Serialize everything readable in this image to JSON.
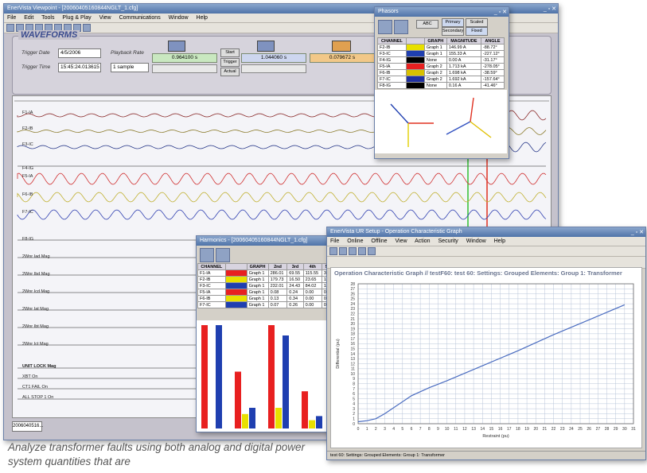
{
  "main": {
    "title": "EnerVista Viewpoint  -  [20060405160844NGLT_1.cfg]",
    "menu": [
      "File",
      "Edit",
      "Tools",
      "Plug & Play",
      "View",
      "Communications",
      "Window",
      "Help"
    ],
    "waveforms_title": "WAVEFORMS",
    "trigger_date_label": "Trigger Date",
    "trigger_date": "4/5/2006",
    "trigger_time_label": "Trigger Time",
    "trigger_time": "15:45:24.013615",
    "playback_label": "Playback Rate",
    "playback_value": "1 sample",
    "cursor1": "0.964100 s",
    "cursor2": "1.044060 s",
    "delta": "0.079672 s",
    "btn_start": "Start",
    "btn_trigger": "Trigger",
    "btn_actual": "Actual",
    "channels": [
      "F1-IA",
      "F2-IB",
      "F3-IC",
      "F4-IG",
      "F5-IA",
      "F6-IB",
      "F7-IC",
      "F8-IG",
      "2Wnr Iad Mag",
      "2Wnr Ibd Mag",
      "2Wnr Icd Mag",
      "2Wnr Iat Mag",
      "2Wnr Ibt Mag",
      "2Wnr Ict Mag"
    ],
    "digital": [
      "UNIT LOCK Mag",
      "XBT    On",
      "CT1 FAIL    On",
      "ALL STOP 1   On"
    ],
    "tab": "2006040516..."
  },
  "phasor": {
    "title": "Phasors",
    "btn_ab": "ABC",
    "btn_primary": "Primary",
    "btn_secondary": "Secondary",
    "btn_scaled": "Scaled",
    "btn_fixed": "Fixed",
    "headers": [
      "CHANNEL",
      "",
      "GRAPH",
      "MAGNITUDE",
      "ANGLE"
    ],
    "rows": [
      {
        "ch": "F2-IB",
        "color": "#e8e000",
        "graph": "Graph 1",
        "mag": "146.99 A",
        "ang": "-88.72°"
      },
      {
        "ch": "F3-IC",
        "color": "#1f3fb0",
        "graph": "Graph 1",
        "mag": "155.33 A",
        "ang": "-227.12°"
      },
      {
        "ch": "F4-IG",
        "color": "#000000",
        "graph": "None",
        "mag": "0.00 A",
        "ang": "-31.17°"
      },
      {
        "ch": "F5-IA",
        "color": "#e82020",
        "graph": "Graph 2",
        "mag": "1.713 kA",
        "ang": "-278.05°"
      },
      {
        "ch": "F6-IB",
        "color": "#d8c000",
        "graph": "Graph 2",
        "mag": "1.698 kA",
        "ang": "-38.59°"
      },
      {
        "ch": "F7-IC",
        "color": "#2030a0",
        "graph": "Graph 2",
        "mag": "1.692 kA",
        "ang": "-157.64°"
      },
      {
        "ch": "F8-IG",
        "color": "#000000",
        "graph": "None",
        "mag": "0.16 A",
        "ang": "-41.46°"
      }
    ]
  },
  "harmonic": {
    "title": "Harmonics  -  [20060405160844NGLT_1.cfg]",
    "headers": [
      "CHANNEL",
      "",
      "GRAPH",
      "2nd",
      "3rd",
      "4th",
      "5th"
    ],
    "rows": [
      {
        "ch": "F1-IA",
        "color": "#e82020",
        "graph": "Graph 1",
        "v": [
          "286.01",
          "69.55",
          "115.55",
          "38.1"
        ]
      },
      {
        "ch": "F2-IB",
        "color": "#e8e000",
        "graph": "Graph 1",
        "v": [
          "179.73",
          "16.50",
          "23.65",
          "10.0"
        ]
      },
      {
        "ch": "F3-IC",
        "color": "#1f3fb0",
        "graph": "Graph 1",
        "v": [
          "232.01",
          "24.43",
          "84.02",
          "15.1"
        ]
      },
      {
        "ch": "F5-IA",
        "color": "#e82020",
        "graph": "Graph 1",
        "v": [
          "0.08",
          "0.24",
          "0.00",
          "0.3"
        ]
      },
      {
        "ch": "F6-IB",
        "color": "#e8e000",
        "graph": "Graph 1",
        "v": [
          "0.13",
          "0.34",
          "0.00",
          "0.3"
        ]
      },
      {
        "ch": "F7-IC",
        "color": "#1f3fb0",
        "graph": "Graph 1",
        "v": [
          "0.07",
          "0.26",
          "0.00",
          "0.3"
        ]
      }
    ],
    "bars": [
      {
        "r": 1.0,
        "y": 0.0,
        "b": 1.0
      },
      {
        "r": 0.55,
        "y": 0.14,
        "b": 0.2
      },
      {
        "r": 1.0,
        "y": 0.2,
        "b": 0.9
      },
      {
        "r": 0.36,
        "y": 0.08,
        "b": 0.12
      }
    ]
  },
  "opchar": {
    "title": "EnerVista UR Setup - Operation Characteristic Graph",
    "menu": [
      "File",
      "Online",
      "Offline",
      "View",
      "Action",
      "Security",
      "Window",
      "Help"
    ],
    "graph_title": "Operation Characteristic Graph // testF60: test 60: Settings: Grouped Elements: Group 1: Transformer",
    "ylabel": "Differential (pu)",
    "xlabel": "Restraint (pu)",
    "status": "test 60: Settings: Grouped Elements: Group 1: Transformer"
  },
  "chart_data": {
    "type": "line",
    "title": "Operation Characteristic Graph // testF60: test 60: Settings: Grouped Elements: Group 1: Transformer",
    "xlabel": "Restraint (pu)",
    "ylabel": "Differential (pu)",
    "xlim": [
      0,
      31
    ],
    "ylim": [
      0,
      28
    ],
    "x": [
      0,
      1,
      2,
      3,
      4,
      6,
      8,
      10,
      14,
      18,
      22,
      26,
      30
    ],
    "y": [
      0.4,
      0.6,
      1.0,
      2.0,
      3.2,
      5.6,
      7.2,
      8.6,
      11.6,
      14.6,
      17.8,
      20.8,
      23.8
    ],
    "grid": true
  },
  "caption": "Analyze transformer faults using both analog and digital power system quantities that are"
}
